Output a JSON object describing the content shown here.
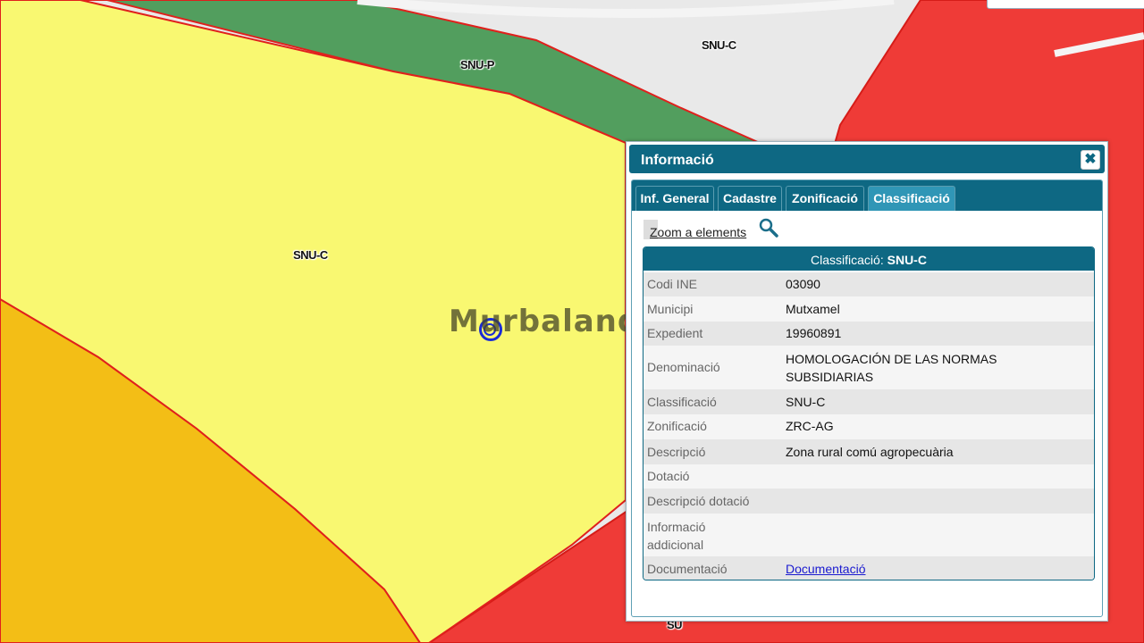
{
  "map": {
    "labels": {
      "snu_p_top": "SNU-P",
      "snu_c_top": "SNU-C",
      "snu_c_center": "SNU-C",
      "su_bottom": "SU"
    },
    "watermark": "Murbalands ®",
    "colors": {
      "yellow_zone": "#f9f871",
      "green_zone": "#529e5e",
      "red_zone": "#ef3b37",
      "orange_zone": "#f3be16",
      "background": "#e9e9e9",
      "border": "#e0201c"
    }
  },
  "panel": {
    "title": "Informació",
    "close_icon": "close-icon",
    "tabs": [
      {
        "label": "Inf. General",
        "active": false
      },
      {
        "label": "Cadastre",
        "active": false
      },
      {
        "label": "Zonificació",
        "active": false
      },
      {
        "label": "Classificació",
        "active": true
      }
    ],
    "zoom_link": "Zoom a elements",
    "zoom_icon": "magnifier-icon",
    "table": {
      "header_prefix": "Classificació: ",
      "header_value": "SNU-C",
      "rows": [
        {
          "label": "Codi INE",
          "value": "03090"
        },
        {
          "label": "Municipi",
          "value": "Mutxamel"
        },
        {
          "label": "Expedient",
          "value": "19960891"
        },
        {
          "label": "Denominació",
          "value": "HOMOLOGACIÓN DE LAS NORMAS SUBSIDIARIAS"
        },
        {
          "label": "Classificació",
          "value": "SNU-C"
        },
        {
          "label": "Zonificació",
          "value": "ZRC-AG"
        },
        {
          "label": "Descripció",
          "value": "Zona rural comú agropecuària"
        },
        {
          "label": "Dotació",
          "value": ""
        },
        {
          "label": "Descripció dotació",
          "value": ""
        },
        {
          "label": "Informació addicional",
          "value": ""
        },
        {
          "label": "Documentació",
          "value": "Documentació"
        }
      ]
    }
  }
}
